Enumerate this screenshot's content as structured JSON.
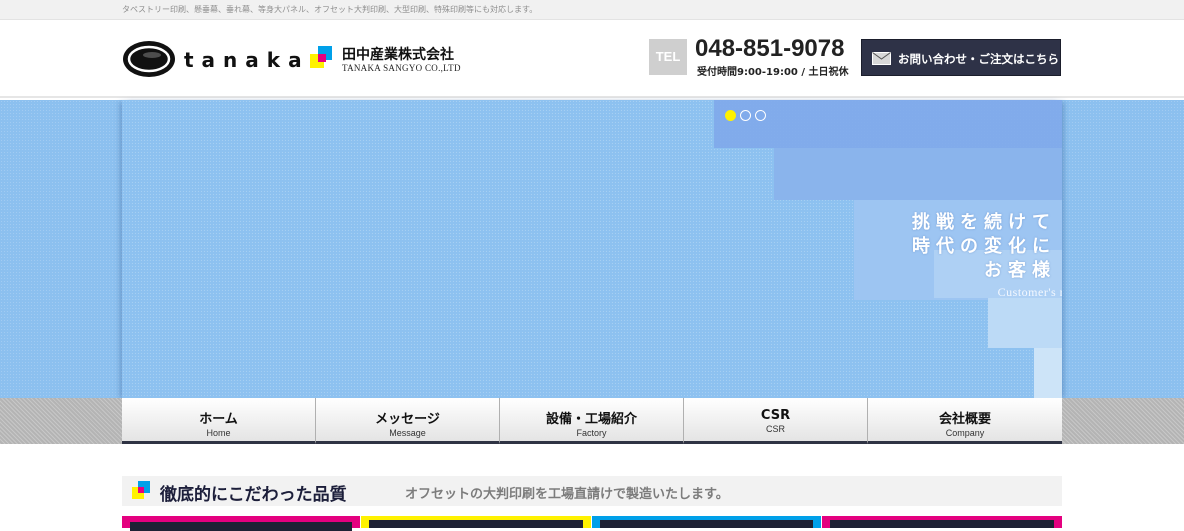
{
  "topbar": {
    "tagline": "タペストリー印刷、懸垂幕、垂れ幕、等身大パネル、オフセット大判印刷、大型印刷、特殊印刷等にも対応します。"
  },
  "header": {
    "logo_word": "tanaka",
    "company_name_jp": "田中産業株式会社",
    "company_name_en": "TANAKA SANGYO CO.,LTD",
    "tel_label": "TEL",
    "tel_number": "048-851-9078",
    "tel_hours": "受付時間9:00-19:00 / 土日祝休",
    "contact_label": "お問い合わせ・ご注文はこちら",
    "contact_icon": "mail-icon"
  },
  "hero": {
    "slide_count": 3,
    "active_slide": 1,
    "slogan_lines": [
      "挑戦を続けて",
      "時代の変化に",
      "お客様"
    ],
    "slogan_en": "Customer's ne",
    "colors": {
      "sky": "#8dc1f0",
      "dot_active": "#fff200"
    }
  },
  "nav": {
    "items": [
      {
        "jp": "ホーム",
        "en": "Home"
      },
      {
        "jp": "メッセージ",
        "en": "Message"
      },
      {
        "jp": "設備・工場紹介",
        "en": "Factory"
      },
      {
        "jp": "CSR",
        "en": "CSR"
      },
      {
        "jp": "会社概要",
        "en": "Company"
      }
    ]
  },
  "section": {
    "title": "徹底的にこだわった品質",
    "subtitle": "オフセットの大判印刷を工場直請けで製造いたします。"
  },
  "brand_colors": {
    "navy": "#2e3247",
    "magenta": "#e4007f",
    "yellow": "#fff200",
    "cyan": "#00a0e9"
  }
}
